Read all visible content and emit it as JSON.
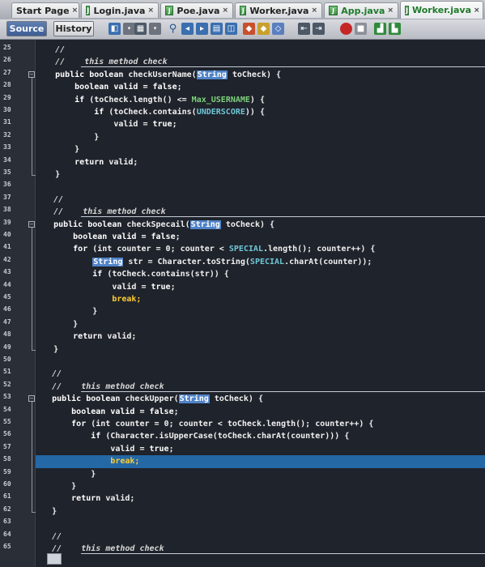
{
  "tabs": [
    {
      "label": "Start Page",
      "close": "×",
      "icon": "none"
    },
    {
      "label": "Login.java",
      "close": "×",
      "icon": "java-file-icon"
    },
    {
      "label": "Poe.java",
      "close": "×",
      "icon": "java-file-icon"
    },
    {
      "label": "Worker.java",
      "close": "×",
      "icon": "java-file-icon"
    },
    {
      "label": "App.java",
      "close": "×",
      "icon": "java-file-icon"
    },
    {
      "label": "Worker.java",
      "close": "×",
      "icon": "java-file-icon"
    }
  ],
  "toolbar": {
    "source_label": "Source",
    "history_label": "History"
  },
  "gutter": {
    "line_numbers": [
      "25",
      "26",
      "27",
      "28",
      "29",
      "30",
      "31",
      "32",
      "33",
      "34",
      "35",
      "36",
      "37",
      "38",
      "39",
      "40",
      "41",
      "42",
      "43",
      "44",
      "45",
      "46",
      "47",
      "48",
      "49",
      "50",
      "51",
      "52",
      "53",
      "54",
      "55",
      "56",
      "57",
      "58",
      "59",
      "60",
      "61",
      "62",
      "63",
      "64",
      "65"
    ]
  },
  "code_lines": [
    [
      {
        "t": "    //",
        "c": "cm"
      }
    ],
    [
      {
        "t": "    //    ",
        "c": "cm"
      },
      {
        "t": "this method check",
        "c": "cm"
      }
    ],
    [
      {
        "t": "    public boolean ",
        "c": "kw"
      },
      {
        "t": "checkUserName(",
        "c": "pl"
      },
      {
        "t": "String",
        "c": "str"
      },
      {
        "t": " toCheck) {",
        "c": "pl"
      }
    ],
    [
      {
        "t": "        boolean valid = ",
        "c": "kw"
      },
      {
        "t": "false",
        "c": "kw"
      },
      {
        "t": ";",
        "c": "pl"
      }
    ],
    [
      {
        "t": "        if ",
        "c": "kw"
      },
      {
        "t": "(toCheck.length() <= ",
        "c": "pl"
      },
      {
        "t": "Max_USERNAME",
        "c": "cst"
      },
      {
        "t": ") {",
        "c": "pl"
      }
    ],
    [
      {
        "t": "            if ",
        "c": "kw"
      },
      {
        "t": "(toCheck.contains(",
        "c": "pl"
      },
      {
        "t": "UNDERSCORE",
        "c": "fld"
      },
      {
        "t": ")) {",
        "c": "pl"
      }
    ],
    [
      {
        "t": "                valid = ",
        "c": "pl"
      },
      {
        "t": "true",
        "c": "kw"
      },
      {
        "t": ";",
        "c": "pl"
      }
    ],
    [
      {
        "t": "            }",
        "c": "pl"
      }
    ],
    [
      {
        "t": "        }",
        "c": "pl"
      }
    ],
    [
      {
        "t": "        return ",
        "c": "kw"
      },
      {
        "t": "valid;",
        "c": "pl"
      }
    ],
    [
      {
        "t": "    }",
        "c": "pl"
      }
    ],
    [
      {
        "t": "",
        "c": "pl"
      }
    ],
    [
      {
        "t": "    //",
        "c": "cm"
      }
    ],
    [
      {
        "t": "    //    ",
        "c": "cm"
      },
      {
        "t": "this method check",
        "c": "cm"
      }
    ],
    [
      {
        "t": "    public boolean ",
        "c": "kw"
      },
      {
        "t": "checkSpecail(",
        "c": "pl"
      },
      {
        "t": "String",
        "c": "str"
      },
      {
        "t": " toCheck) {",
        "c": "pl"
      }
    ],
    [
      {
        "t": "        boolean valid = ",
        "c": "kw"
      },
      {
        "t": "false",
        "c": "kw"
      },
      {
        "t": ";",
        "c": "pl"
      }
    ],
    [
      {
        "t": "        for ",
        "c": "kw"
      },
      {
        "t": "(int counter = 0; counter < ",
        "c": "pl"
      },
      {
        "t": "SPECIAL",
        "c": "fld"
      },
      {
        "t": ".length(); counter++) {",
        "c": "pl"
      }
    ],
    [
      {
        "t": "            ",
        "c": "pl"
      },
      {
        "t": "String",
        "c": "str"
      },
      {
        "t": " str = Character.toString(",
        "c": "pl"
      },
      {
        "t": "SPECIAL",
        "c": "fld"
      },
      {
        "t": ".charAt(counter));",
        "c": "pl"
      }
    ],
    [
      {
        "t": "            if ",
        "c": "kw"
      },
      {
        "t": "(toCheck.contains(str)) {",
        "c": "pl"
      }
    ],
    [
      {
        "t": "                valid = ",
        "c": "pl"
      },
      {
        "t": "true",
        "c": "kw"
      },
      {
        "t": ";",
        "c": "pl"
      }
    ],
    [
      {
        "t": "                break;",
        "c": "val"
      }
    ],
    [
      {
        "t": "            }",
        "c": "pl"
      }
    ],
    [
      {
        "t": "        }",
        "c": "pl"
      }
    ],
    [
      {
        "t": "        return ",
        "c": "kw"
      },
      {
        "t": "valid;",
        "c": "pl"
      }
    ],
    [
      {
        "t": "    }",
        "c": "pl"
      }
    ],
    [
      {
        "t": "",
        "c": "pl"
      }
    ],
    [
      {
        "t": "    //",
        "c": "cm"
      }
    ],
    [
      {
        "t": "    //    ",
        "c": "cm"
      },
      {
        "t": "this method check",
        "c": "cm"
      }
    ],
    [
      {
        "t": "    public boolean ",
        "c": "kw"
      },
      {
        "t": "checkUpper(",
        "c": "pl"
      },
      {
        "t": "String",
        "c": "str"
      },
      {
        "t": " toCheck) {",
        "c": "pl"
      }
    ],
    [
      {
        "t": "        boolean valid = ",
        "c": "kw"
      },
      {
        "t": "false",
        "c": "kw"
      },
      {
        "t": ";",
        "c": "pl"
      }
    ],
    [
      {
        "t": "        for ",
        "c": "kw"
      },
      {
        "t": "(int counter = 0; counter < toCheck.length(); counter++) {",
        "c": "pl"
      }
    ],
    [
      {
        "t": "            if ",
        "c": "kw"
      },
      {
        "t": "(Character.isUpperCase(toCheck.charAt(counter))) {",
        "c": "pl"
      }
    ],
    [
      {
        "t": "                valid = ",
        "c": "pl"
      },
      {
        "t": "true",
        "c": "kw"
      },
      {
        "t": ";",
        "c": "pl"
      }
    ],
    [
      {
        "t": "                break;",
        "c": "val"
      }
    ],
    [
      {
        "t": "            }",
        "c": "pl"
      }
    ],
    [
      {
        "t": "        }",
        "c": "pl"
      }
    ],
    [
      {
        "t": "        return ",
        "c": "kw"
      },
      {
        "t": "valid;",
        "c": "pl"
      }
    ],
    [
      {
        "t": "    }",
        "c": "pl"
      }
    ],
    [
      {
        "t": "",
        "c": "pl"
      }
    ],
    [
      {
        "t": "    //",
        "c": "cm"
      }
    ],
    [
      {
        "t": "    //    ",
        "c": "cm"
      },
      {
        "t": "this method check",
        "c": "cm"
      }
    ]
  ],
  "highlighted_line": "58"
}
